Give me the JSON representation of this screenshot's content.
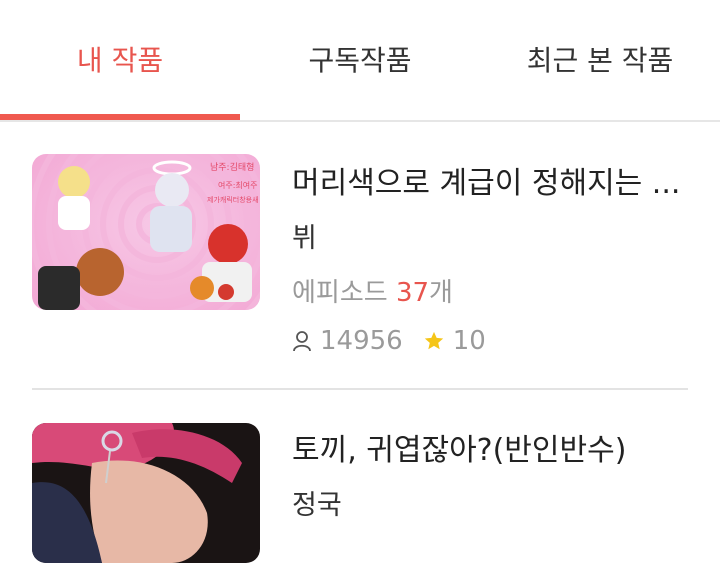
{
  "tabs": [
    {
      "label": "내 작품",
      "active": true
    },
    {
      "label": "구독작품",
      "active": false
    },
    {
      "label": "최근 본 작품",
      "active": false
    }
  ],
  "colors": {
    "accent": "#f0594f",
    "muted": "#9a9a9a",
    "star": "#f5c518",
    "divider": "#e3e3e3"
  },
  "works": [
    {
      "title": "머리색으로 계급이 정해지는 ...",
      "author": "뷔",
      "episodes_prefix": "에피소드",
      "episodes_count": "37",
      "episodes_suffix": "개",
      "views": "14956",
      "stars": "10",
      "thumbnail_text": [
        "남주:김태형",
        "여주:최여주",
        "제가캐릭터창용새"
      ]
    },
    {
      "title": "토끼, 귀엽잖아?(반인반수)",
      "author": "정국"
    }
  ],
  "icons": {
    "views": "person-icon",
    "stars": "star-icon"
  }
}
